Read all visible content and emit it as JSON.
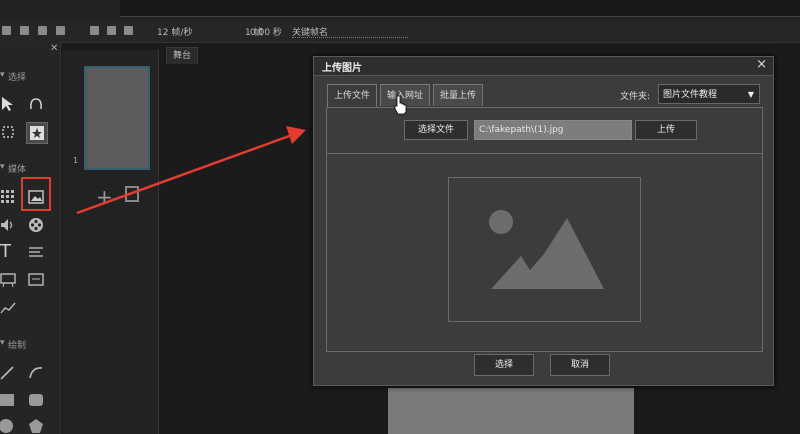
{
  "toolbar": {
    "frames": "12 帧/秒",
    "frame_count": "1 帧",
    "seconds": "0.00 秒",
    "keyframe_name": "关键帧名"
  },
  "left_panel": {
    "section_select": "选择",
    "section_media": "媒体",
    "section_draw": "绘制"
  },
  "thumbnails": {
    "page_number": "1"
  },
  "stage": {
    "tab_label": "舞台"
  },
  "dialog": {
    "title": "上传图片",
    "close": "×",
    "tabs": [
      {
        "label": "上传文件",
        "active": true
      },
      {
        "label": "输入网址",
        "active": false
      },
      {
        "label": "批量上传",
        "active": false
      }
    ],
    "folder_label": "文件夹:",
    "folder_value": "图片文件教程",
    "choose_file_button": "选择文件",
    "file_path": "C:\\fakepath\\(1).jpg",
    "upload_button": "上传",
    "select_button": "选择",
    "cancel_button": "取消"
  },
  "icons": {
    "annotation_arrow_color": "#e23b30",
    "selection_box_color": "#e23b30"
  }
}
